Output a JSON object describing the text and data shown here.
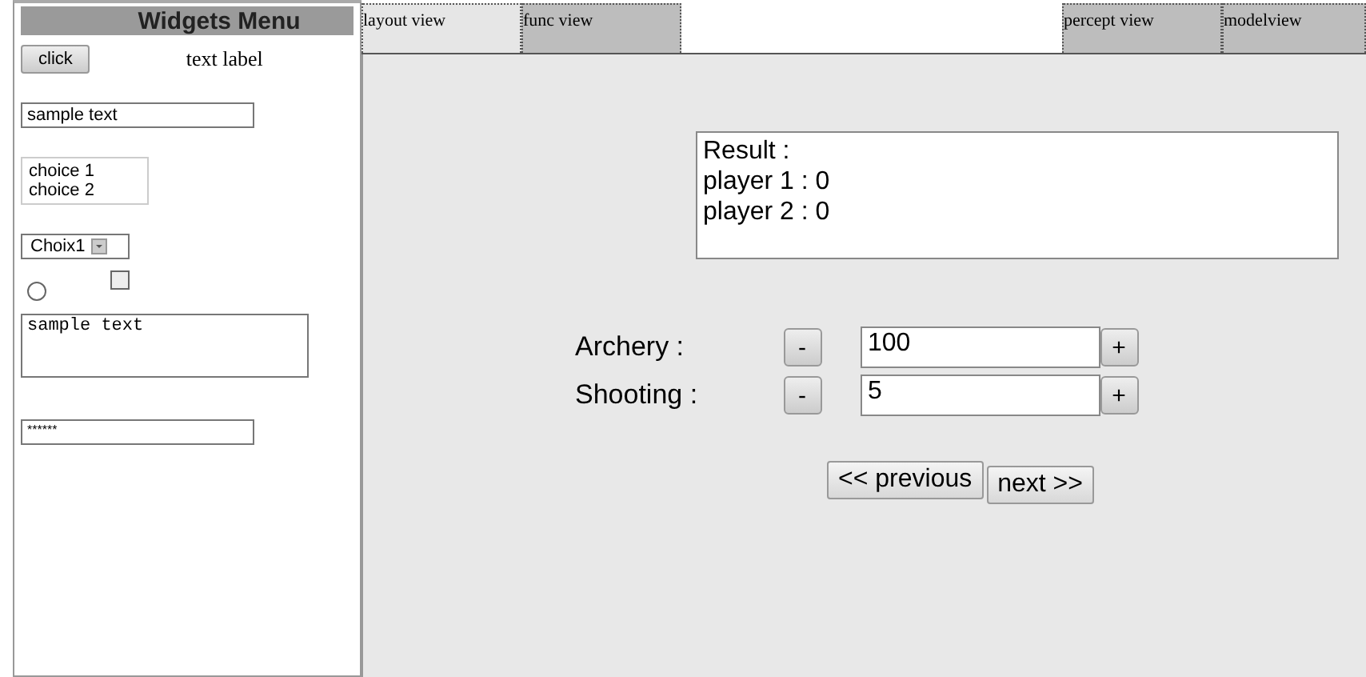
{
  "widgets_menu": {
    "title": "Widgets Menu",
    "button": "click",
    "label": "text label",
    "text_field": "sample text",
    "list": [
      "choice 1",
      "choice 2"
    ],
    "dropdown": "Choix1",
    "radio": {
      "checked": false
    },
    "checkbox": {
      "checked": false
    },
    "text_area": "sample text",
    "password": "******"
  },
  "tabs": [
    {
      "label": "layout view",
      "selected": true
    },
    {
      "label": "func view",
      "selected": false
    },
    {
      "label": "percept view",
      "selected": false
    },
    {
      "label": "modelview",
      "selected": false
    }
  ],
  "result": [
    "Result :",
    "player 1 : 0",
    "player 2 : 0"
  ],
  "spinners": [
    {
      "label": "Archery :",
      "minus": "-",
      "value": "100",
      "plus": "+"
    },
    {
      "label": "Shooting :",
      "minus": "-",
      "value": "5",
      "plus": "+"
    }
  ],
  "nav": [
    "<< previous",
    "next >>"
  ]
}
